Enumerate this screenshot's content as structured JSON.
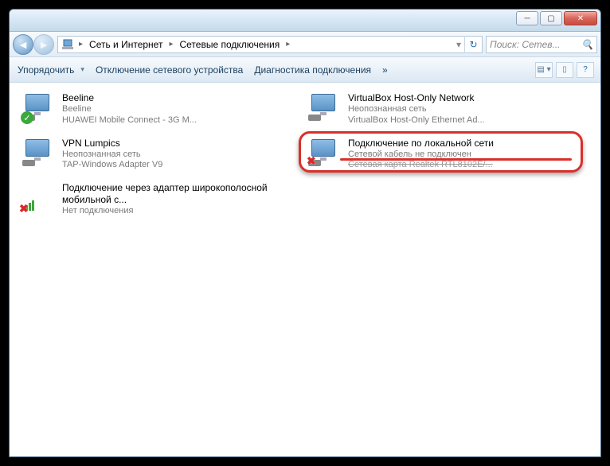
{
  "breadcrumb": {
    "sep": "▸",
    "root": "Сеть и Интернет",
    "current": "Сетевые подключения"
  },
  "search": {
    "placeholder": "Поиск: Сетев..."
  },
  "toolbar": {
    "organize": "Упорядочить",
    "disable": "Отключение сетевого устройства",
    "diag": "Диагностика подключения",
    "more": "»"
  },
  "items": {
    "left": [
      {
        "name": "Beeline",
        "status": "Beeline",
        "desc": "HUAWEI Mobile Connect - 3G M...",
        "badge": "check"
      },
      {
        "name": "VPN Lumpics",
        "status": "Неопознанная сеть",
        "desc": "TAP-Windows Adapter V9",
        "badge": "none"
      },
      {
        "name": "Подключение через адаптер широкополосной мобильной с...",
        "status": "Нет подключения",
        "desc": "",
        "badge": "bars-x"
      }
    ],
    "right": [
      {
        "name": "VirtualBox Host-Only Network",
        "status": "Неопознанная сеть",
        "desc": "VirtualBox Host-Only Ethernet Ad...",
        "badge": "none"
      },
      {
        "name": "Подключение по локальной сети",
        "status": "Сетевой кабель не подключен",
        "desc": "Сетевая карта Realtek RTL8102E/...",
        "badge": "x",
        "highlight": true
      }
    ]
  }
}
